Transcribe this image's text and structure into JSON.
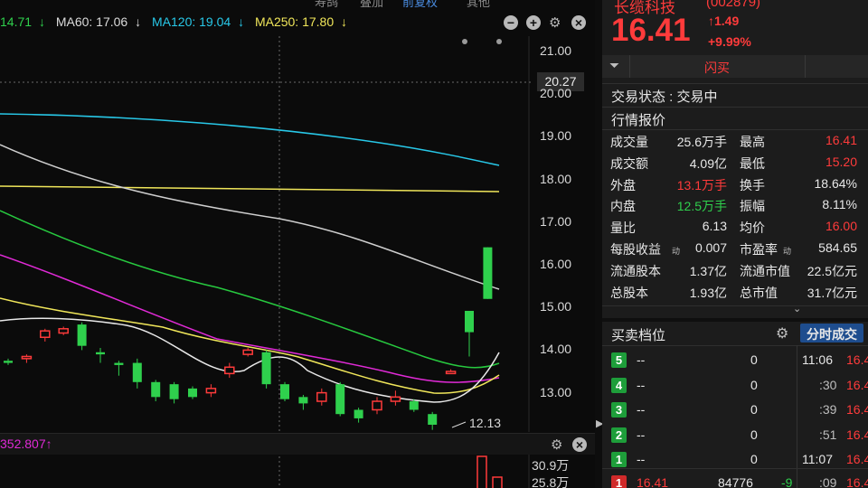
{
  "top_menu": {
    "item1": "寿鸽",
    "item2": "叠加",
    "item3": "前复权",
    "item4": "其他"
  },
  "ma": [
    {
      "label": "14.71",
      "arrow": "↓",
      "color": "#2fd04d"
    },
    {
      "label": "MA60: 17.06",
      "arrow": "↓",
      "color": "#dcdcdc"
    },
    {
      "label": "MA120: 19.04",
      "arrow": "↓",
      "color": "#28c8e8"
    },
    {
      "label": "MA250: 17.80",
      "arrow": "↓",
      "color": "#f0e65a"
    }
  ],
  "y_axis": [
    "21.00",
    "20.00",
    "19.00",
    "18.00",
    "17.00",
    "16.00",
    "15.00",
    "14.00",
    "13.00"
  ],
  "price_tag": "20.27",
  "low_label": "12.13",
  "volume": {
    "indicator": "352.807↑",
    "ticks": [
      "30.9万",
      "25.8万"
    ]
  },
  "header": {
    "name": "长缆科技",
    "code": "(002879)",
    "price": "16.41",
    "change": "↑1.49",
    "pct": "+9.99%",
    "flash": "闪买"
  },
  "status": {
    "label": "交易状态 : 交易中"
  },
  "quote_title": "行情报价",
  "quotes": [
    {
      "l": "成交量",
      "v": "25.6万手",
      "l2": "最高",
      "v2": "16.41",
      "c2": "red"
    },
    {
      "l": "成交额",
      "v": "4.09亿",
      "l2": "最低",
      "v2": "15.20",
      "c2": "red"
    },
    {
      "l": "外盘",
      "v": "13.1万手",
      "c": "red",
      "l2": "换手",
      "v2": "18.64%"
    },
    {
      "l": "内盘",
      "v": "12.5万手",
      "c": "green",
      "l2": "振幅",
      "v2": "8.11%"
    },
    {
      "l": "量比",
      "v": "6.13",
      "l2": "均价",
      "v2": "16.00",
      "c2": "red"
    },
    {
      "l": "每股收益",
      "sup": "动",
      "v": "0.007",
      "l2": "市盈率",
      "sup2": "动",
      "v2": "584.65"
    },
    {
      "l": "流通股本",
      "v": "1.37亿",
      "l2": "流通市值",
      "v2": "22.5亿元"
    },
    {
      "l": "总股本",
      "v": "1.93亿",
      "l2": "总市值",
      "v2": "31.7亿元"
    }
  ],
  "book_title": "买卖档位",
  "ticks_title": "分时成交",
  "book": [
    {
      "n": "5",
      "p": "--",
      "q": "0",
      "t": "11:06",
      "tp": "16.4"
    },
    {
      "n": "4",
      "p": "--",
      "q": "0",
      "t": ":30",
      "tp": "16.4"
    },
    {
      "n": "3",
      "p": "--",
      "q": "0",
      "t": ":39",
      "tp": "16.4"
    },
    {
      "n": "2",
      "p": "--",
      "q": "0",
      "t": ":51",
      "tp": "16.4"
    },
    {
      "n": "1",
      "p": "--",
      "q": "0",
      "t": "11:07",
      "tp": "16.4"
    }
  ],
  "bid1": {
    "n": "1",
    "p": "16.41",
    "q": "84776",
    "d": "-9",
    "t": ":09",
    "tp": "16.4"
  },
  "chart_data": {
    "type": "candlestick",
    "ylim": [
      12.0,
      21.2
    ],
    "candles": [
      [
        13.75,
        13.7,
        13.8,
        13.65
      ],
      [
        13.8,
        13.85,
        13.9,
        13.7
      ],
      [
        14.3,
        14.45,
        14.5,
        14.2
      ],
      [
        14.4,
        14.5,
        14.55,
        14.35
      ],
      [
        14.6,
        14.1,
        14.65,
        14.0
      ],
      [
        13.95,
        13.9,
        14.05,
        13.7
      ],
      [
        13.7,
        13.65,
        13.75,
        13.4
      ],
      [
        13.7,
        13.25,
        13.8,
        13.1
      ],
      [
        13.25,
        12.9,
        13.3,
        12.8
      ],
      [
        13.2,
        12.85,
        13.25,
        12.75
      ],
      [
        13.1,
        12.9,
        13.15,
        12.85
      ],
      [
        13.0,
        13.1,
        13.2,
        12.9
      ],
      [
        13.45,
        13.6,
        13.7,
        13.35
      ],
      [
        13.9,
        14.0,
        14.05,
        13.85
      ],
      [
        13.95,
        13.2,
        14.0,
        13.1
      ],
      [
        13.2,
        12.85,
        13.25,
        12.8
      ],
      [
        12.9,
        12.75,
        12.95,
        12.6
      ],
      [
        12.8,
        13.0,
        13.1,
        12.7
      ],
      [
        13.2,
        12.5,
        13.25,
        12.45
      ],
      [
        12.6,
        12.4,
        12.65,
        12.3
      ],
      [
        12.6,
        12.8,
        12.9,
        12.5
      ],
      [
        12.8,
        12.9,
        13.05,
        12.7
      ],
      [
        12.8,
        12.6,
        12.85,
        12.55
      ],
      [
        12.5,
        12.25,
        12.55,
        12.13
      ],
      [
        13.45,
        13.5,
        13.55,
        13.45
      ],
      [
        14.92,
        14.42,
        14.92,
        13.85
      ],
      [
        16.41,
        15.2,
        16.41,
        15.2
      ]
    ]
  }
}
